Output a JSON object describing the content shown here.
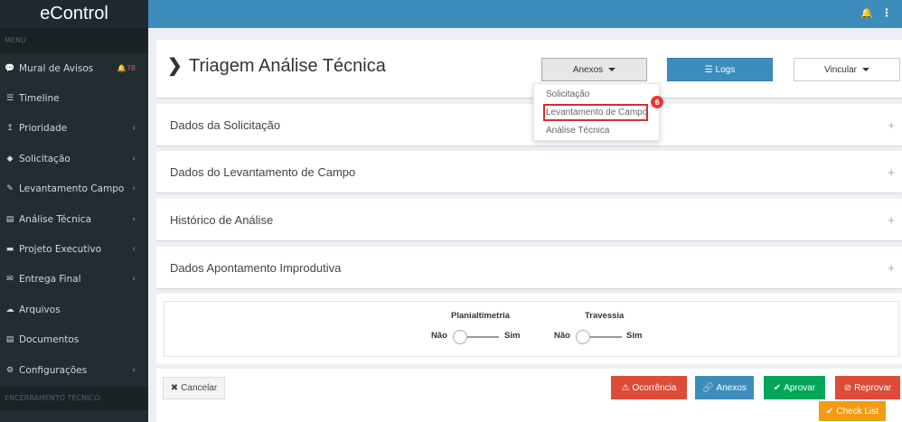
{
  "app": {
    "logo": "eControl"
  },
  "sidebar": {
    "menu_header": "MENU",
    "items": [
      {
        "label": "Mural de Avisos",
        "icon": "chat-icon",
        "glyph": "💬",
        "badge": "78"
      },
      {
        "label": "Timeline",
        "icon": "list-icon",
        "glyph": "☰"
      },
      {
        "label": "Prioridade",
        "icon": "sort-icon",
        "glyph": "↥",
        "chevron": "‹"
      },
      {
        "label": "Solicitação",
        "icon": "tag-icon",
        "glyph": "◆",
        "chevron": "‹"
      },
      {
        "label": "Levantamento Campo",
        "icon": "magic-wand-icon",
        "glyph": "✎",
        "chevron": "‹"
      },
      {
        "label": "Análise Técnica",
        "icon": "file-icon",
        "glyph": "▤",
        "chevron": "‹"
      },
      {
        "label": "Projeto Executivo",
        "icon": "briefcase-icon",
        "glyph": "▬",
        "chevron": "‹"
      },
      {
        "label": "Entrega Final",
        "icon": "envelope-icon",
        "glyph": "✉",
        "chevron": "‹"
      },
      {
        "label": "Arquivos",
        "icon": "cloud-icon",
        "glyph": "☁"
      },
      {
        "label": "Documentos",
        "icon": "document-icon",
        "glyph": "▤"
      },
      {
        "label": "Configurações",
        "icon": "cogs-icon",
        "glyph": "⚙",
        "chevron": "‹"
      }
    ],
    "footer_header": "ENCERRAMENTO TÉCNICO"
  },
  "topbar": {
    "bell_glyph": "🔔",
    "menu_glyph": "⋮"
  },
  "page": {
    "title": "Triagem Análise Técnica",
    "title_chevron": "❯",
    "buttons": {
      "anexos": "Anexos",
      "logs": "Logs",
      "vincular": "Vincular"
    }
  },
  "dropdown": {
    "items": [
      "Solicitação",
      "Levantamento de Campo",
      "Análise Técnica"
    ],
    "marker": "6"
  },
  "accordions": [
    {
      "label": "Dados da Solicitação"
    },
    {
      "label": "Dados do Levantamento de Campo"
    },
    {
      "label": "Histórico de Análise"
    },
    {
      "label": "Dados Apontamento Improdutiva"
    }
  ],
  "plus_glyph": "+",
  "toggles": [
    {
      "label": "Planialtimetria",
      "off": "Não",
      "on": "Sim",
      "value": "Não"
    },
    {
      "label": "Travessia",
      "off": "Não",
      "on": "Sim",
      "value": "Não"
    }
  ],
  "actions": {
    "cancel": "Cancelar",
    "ocorrencia": "Ocorrência",
    "anexos": "Anexos",
    "aprovar": "Aprovar",
    "reprovar": "Reprovar",
    "checklist": "Check List"
  },
  "colors": {
    "sidebar": "#222d32",
    "topbar": "#3c8dbc",
    "danger": "#dd4b39",
    "success": "#00a65a",
    "warning": "#f39c12",
    "primary": "#3c8dbc"
  }
}
